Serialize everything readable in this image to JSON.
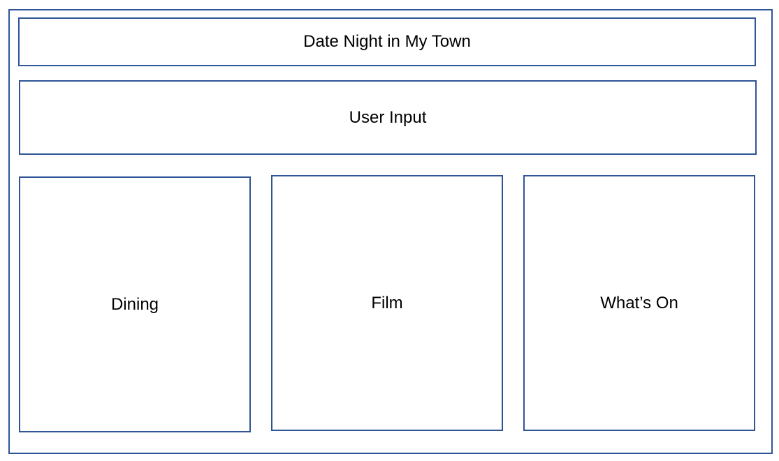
{
  "colors": {
    "border": "#2F5597",
    "background": "#FFFFFF",
    "text": "#000000"
  },
  "header": {
    "title": "Date Night in My Town"
  },
  "input_section": {
    "label": "User Input"
  },
  "panels": [
    {
      "label": "Dining"
    },
    {
      "label": "Film"
    },
    {
      "label": "What’s On"
    }
  ]
}
